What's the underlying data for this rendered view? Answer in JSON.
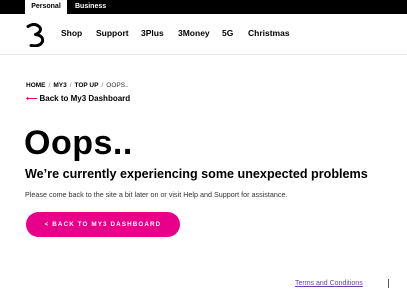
{
  "segment_tabs": {
    "personal": "Personal",
    "business": "Business"
  },
  "logo": {
    "icon": "three-logo-icon"
  },
  "nav": {
    "items": [
      {
        "label": "Shop"
      },
      {
        "label": "Support"
      },
      {
        "label": "3Plus"
      },
      {
        "label": "3Money"
      },
      {
        "label": "5G"
      },
      {
        "label": "Christmas"
      }
    ]
  },
  "breadcrumb": {
    "items": [
      "HOME",
      "MY3",
      "TOP UP",
      "OOPS.."
    ],
    "separator": "/"
  },
  "back_link": {
    "arrow": "⟵",
    "label": "Back to My3 Dashboard"
  },
  "main": {
    "title": "Oops..",
    "subtitle": "We’re currently experiencing some unexpected problems",
    "description": "Please come back to the site a bit later on or visit Help and Support for assistance.",
    "cta_label": "< BACK TO MY3 DASHBOARD"
  },
  "footer": {
    "terms_label": "Terms and Conditions"
  },
  "colors": {
    "accent": "#e8008b",
    "link": "#6a3ea8",
    "topbar": "#000000"
  }
}
